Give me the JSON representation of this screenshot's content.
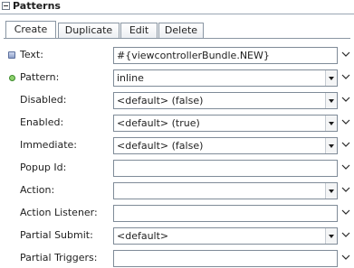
{
  "panel": {
    "title": "Patterns"
  },
  "tabs": [
    {
      "label": "Create",
      "selected": true
    },
    {
      "label": "Duplicate",
      "selected": false
    },
    {
      "label": "Edit",
      "selected": false
    },
    {
      "label": "Delete",
      "selected": false
    }
  ],
  "properties": [
    {
      "label": "Text:",
      "value": "#{viewcontrollerBundle.NEW}",
      "icon": "binding-icon",
      "control": "text"
    },
    {
      "label": "Pattern:",
      "value": "inline",
      "icon": "required-icon",
      "control": "combo"
    },
    {
      "label": "Disabled:",
      "value": "<default> (false)",
      "control": "combo"
    },
    {
      "label": "Enabled:",
      "value": "<default> (true)",
      "control": "combo"
    },
    {
      "label": "Immediate:",
      "value": "<default> (false)",
      "control": "combo"
    },
    {
      "label": "Popup Id:",
      "value": "",
      "control": "text"
    },
    {
      "label": "Action:",
      "value": "",
      "control": "combo"
    },
    {
      "label": "Action Listener:",
      "value": "",
      "control": "text"
    },
    {
      "label": "Partial Submit:",
      "value": "<default>",
      "control": "combo"
    },
    {
      "label": "Partial Triggers:",
      "value": "",
      "control": "text"
    }
  ],
  "icons": {
    "section_toggle": "collapse-minus-icon",
    "row_menu": "chevron-down-icon",
    "combo_arrow": "dropdown-arrow-icon"
  },
  "colors": {
    "border": "#7f8b98",
    "required": "#8fd16f"
  }
}
